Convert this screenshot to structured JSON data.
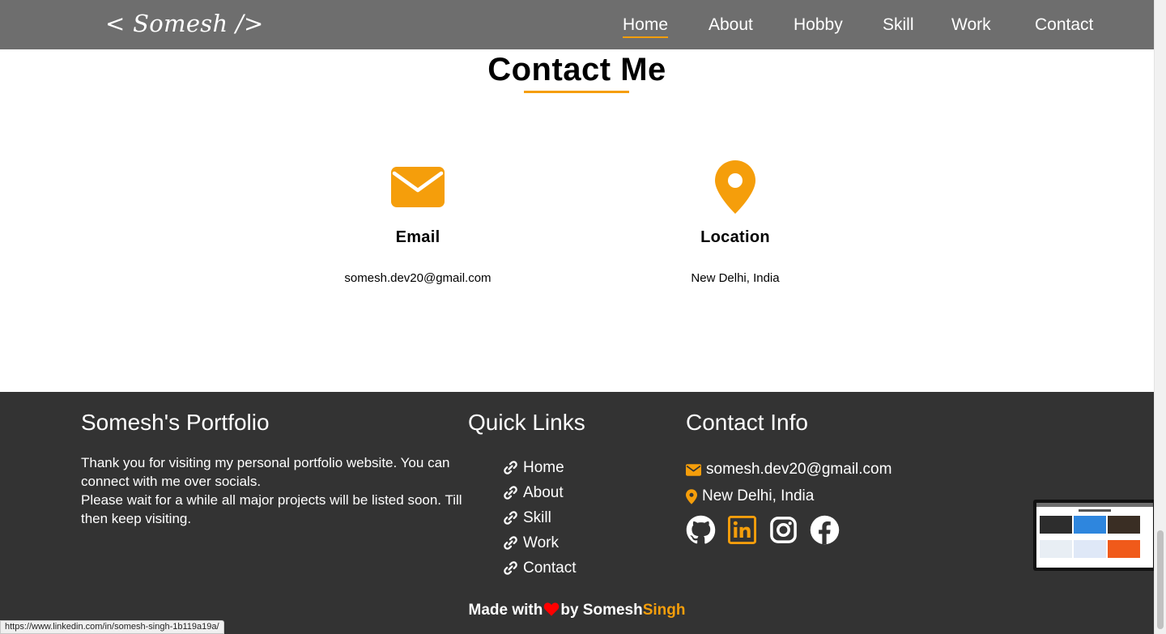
{
  "nav": {
    "brand": "< Somesh />",
    "links": [
      "Home",
      "About",
      "Hobby",
      "Skill",
      "Work",
      "Contact"
    ]
  },
  "contact": {
    "title": "Contact Me",
    "email": {
      "label": "Email",
      "value": "somesh.dev20@gmail.com"
    },
    "location": {
      "label": "Location",
      "value": "New Delhi, India"
    }
  },
  "footer": {
    "portfolio": {
      "title": "Somesh's Portfolio",
      "text_1": "Thank you for visiting my personal portfolio website. You can connect with me over socials.",
      "text_2": "Please wait for a while all major projects will be listed soon. Till then keep visiting."
    },
    "quick_links": {
      "title": "Quick Links",
      "items": [
        "Home",
        "About",
        "Skill",
        "Work",
        "Contact"
      ]
    },
    "contact_info": {
      "title": "Contact Info",
      "email": "somesh.dev20@gmail.com",
      "location": "New Delhi, India"
    },
    "socials": [
      "github-icon",
      "linkedin-icon",
      "instagram-icon",
      "facebook-icon"
    ],
    "made_with_prefix": "Made with",
    "made_with_by": "by Somesh",
    "made_with_accent": "Singh"
  },
  "status_url": "https://www.linkedin.com/in/somesh-singh-1b119a19a/",
  "colors": {
    "accent": "#f59e0b",
    "navbar": "#6e6e6e",
    "footer": "#333333",
    "heart": "#ff0000",
    "linkedin_active": "#f59e0b"
  }
}
